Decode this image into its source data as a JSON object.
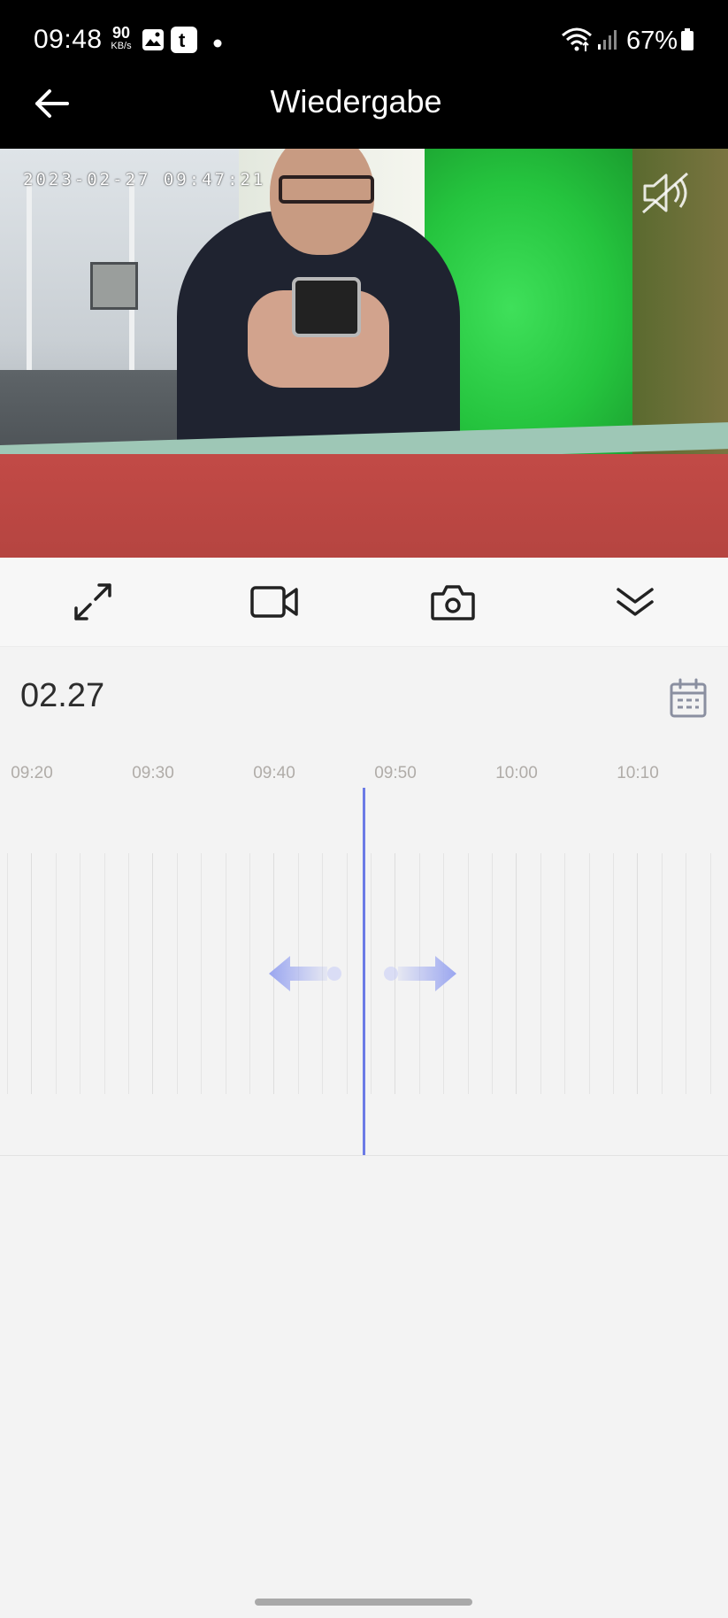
{
  "status_bar": {
    "time": "09:48",
    "net_speed_value": "90",
    "net_speed_unit": "KB/s",
    "battery_percent": "67%",
    "icons": [
      "gallery-icon",
      "tumblr-icon",
      "dot-icon",
      "wifi-icon",
      "signal-icon",
      "battery-icon"
    ]
  },
  "app_bar": {
    "title": "Wiedergabe",
    "back_icon": "arrow-left-icon"
  },
  "video": {
    "timestamp_overlay": "2023-02-27 09:47:21",
    "mute_icon": "speaker-muted-icon"
  },
  "controls": [
    {
      "name": "fullscreen-button",
      "icon": "expand-icon"
    },
    {
      "name": "record-button",
      "icon": "video-camera-icon"
    },
    {
      "name": "snapshot-button",
      "icon": "camera-icon"
    },
    {
      "name": "collapse-button",
      "icon": "double-chevron-down-icon"
    }
  ],
  "date": {
    "label": "02.27",
    "calendar_icon": "calendar-icon"
  },
  "timeline": {
    "labels": [
      "09:20",
      "09:30",
      "09:40",
      "09:50",
      "10:00",
      "10:10"
    ],
    "cursor_color": "#6c7be6",
    "swipe_hint_icons": [
      "swipe-left-arrow-icon",
      "swipe-right-arrow-icon"
    ]
  },
  "colors": {
    "accent": "#6c7be6",
    "background": "#f3f3f3",
    "header": "#000000"
  }
}
